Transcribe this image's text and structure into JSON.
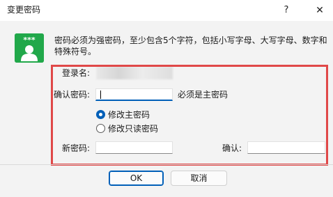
{
  "window": {
    "title": "变更密码",
    "help_glyph": "?",
    "close_glyph": "✕"
  },
  "icon": {
    "name": "password-user-icon",
    "stars": "***",
    "color": "#21a84a"
  },
  "info": {
    "message": "密码必须为强密码，至少包含5个字符，包括小写字母、大写字母、数字和特殊符号。"
  },
  "form": {
    "login_name_label": "登录名:",
    "login_name_value": "********",
    "confirm_password_label": "确认密码:",
    "confirm_password_value": "",
    "confirm_password_hint": "必须是主密码",
    "radio_options": [
      {
        "label": "修改主密码",
        "selected": true
      },
      {
        "label": "修改只读密码",
        "selected": false
      }
    ],
    "new_password_label": "新密码:",
    "new_password_value": "",
    "confirm_label": "确认:",
    "confirm_value": ""
  },
  "buttons": {
    "ok_label": "OK",
    "cancel_label": "取消"
  },
  "colors": {
    "accent": "#005fb8",
    "highlight": "#e04848"
  }
}
